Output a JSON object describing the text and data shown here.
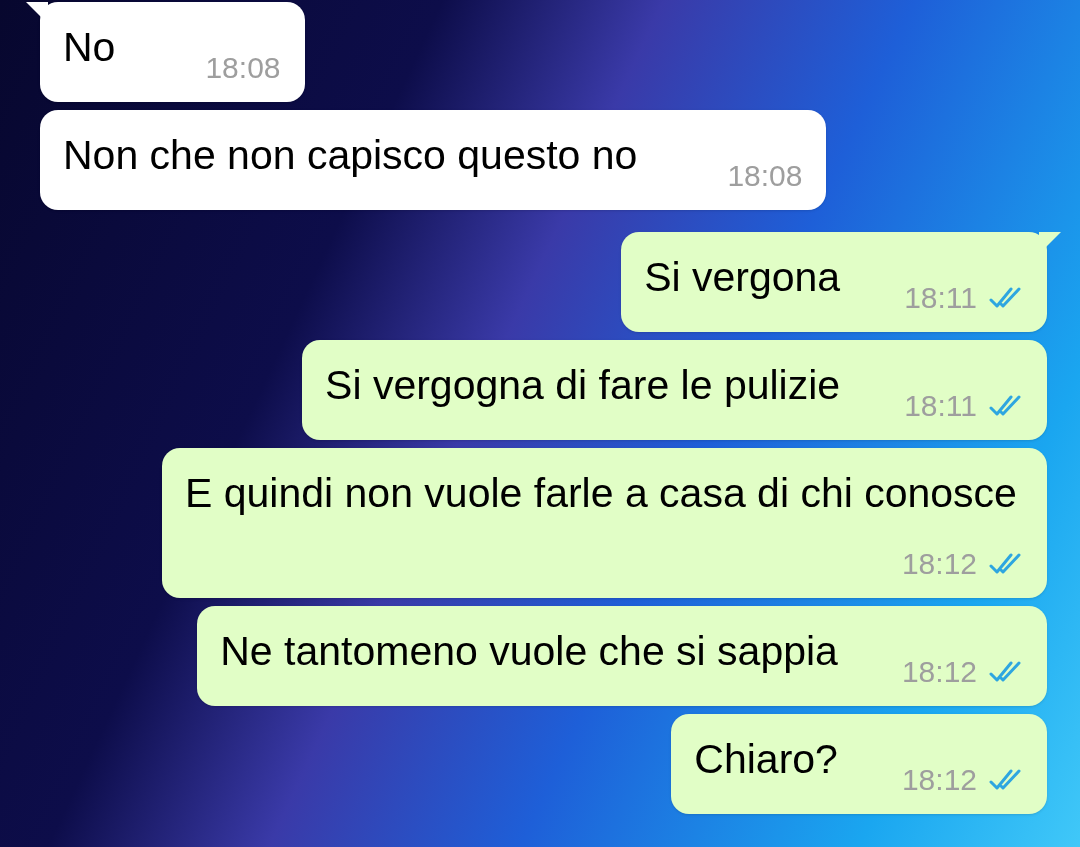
{
  "messages": [
    {
      "kind": "incoming",
      "tail": true,
      "text": "No",
      "time": "18:08"
    },
    {
      "kind": "incoming",
      "tail": false,
      "text": "Non che non capisco questo no",
      "time": "18:08"
    },
    {
      "kind": "outgoing",
      "tail": true,
      "text": "Si vergona",
      "time": "18:11",
      "read": true
    },
    {
      "kind": "outgoing",
      "tail": false,
      "text": "Si vergogna di fare le pulizie",
      "time": "18:11",
      "read": true
    },
    {
      "kind": "outgoing",
      "tail": false,
      "text": "E quindi non vuole farle a casa di chi conosce",
      "time": "18:12",
      "read": true
    },
    {
      "kind": "outgoing",
      "tail": false,
      "text": "Ne tantomeno vuole che si sappia",
      "time": "18:12",
      "read": true
    },
    {
      "kind": "outgoing",
      "tail": false,
      "text": "Chiaro?",
      "time": "18:12",
      "read": true
    }
  ]
}
